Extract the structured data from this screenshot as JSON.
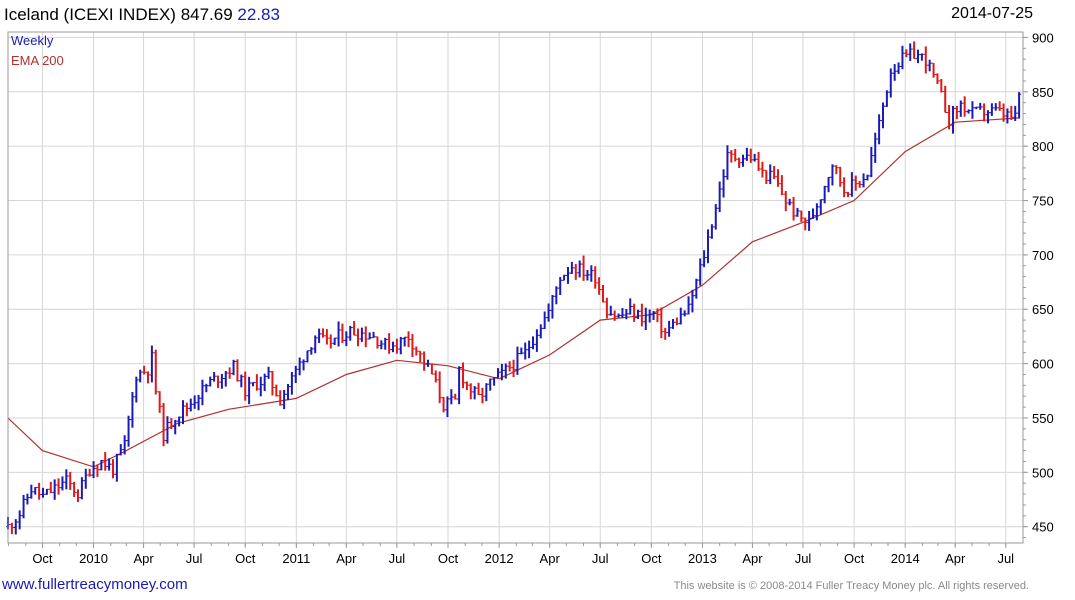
{
  "header": {
    "title": "Iceland (ICEXI INDEX)",
    "last": "847.69",
    "change": "22.83",
    "date": "2014-07-25"
  },
  "footer": {
    "link": "www.fullertreacymoney.com",
    "copyright": "This website is © 2008-2014 Fuller Treacy Money plc. All rights reserved."
  },
  "colors": {
    "up": "#1a1ab4",
    "down": "#dd1a1a",
    "ema": "#b03030",
    "grid": "#d6d6d6",
    "frame": "#9a9a9a"
  },
  "chart_data": {
    "type": "candlestick",
    "legend": [
      "Weekly",
      "EMA 200"
    ],
    "legend_colors": [
      "#1a1ab4",
      "#b03030"
    ],
    "y_ticks": [
      450,
      500,
      550,
      600,
      650,
      700,
      750,
      800,
      850,
      900
    ],
    "ylim": [
      435,
      905
    ],
    "x_ticks": [
      {
        "label": "Oct",
        "date": "2009-10-01"
      },
      {
        "label": "2010",
        "date": "2010-01-01"
      },
      {
        "label": "Apr",
        "date": "2010-04-01"
      },
      {
        "label": "Jul",
        "date": "2010-07-01"
      },
      {
        "label": "Oct",
        "date": "2010-10-01"
      },
      {
        "label": "2011",
        "date": "2011-01-01"
      },
      {
        "label": "Apr",
        "date": "2011-04-01"
      },
      {
        "label": "Jul",
        "date": "2011-07-01"
      },
      {
        "label": "Oct",
        "date": "2011-10-01"
      },
      {
        "label": "2012",
        "date": "2012-01-01"
      },
      {
        "label": "Apr",
        "date": "2012-04-01"
      },
      {
        "label": "Jul",
        "date": "2012-07-01"
      },
      {
        "label": "Oct",
        "date": "2012-10-01"
      },
      {
        "label": "2013",
        "date": "2013-01-01"
      },
      {
        "label": "Apr",
        "date": "2013-04-01"
      },
      {
        "label": "Jul",
        "date": "2013-07-01"
      },
      {
        "label": "Oct",
        "date": "2013-10-01"
      },
      {
        "label": "2014",
        "date": "2014-01-01"
      },
      {
        "label": "Apr",
        "date": "2014-04-01"
      },
      {
        "label": "Jul",
        "date": "2014-07-01"
      }
    ],
    "x_range": [
      "2009-07-31",
      "2014-08-01"
    ],
    "close_path": [
      [
        "2009-07-31",
        450
      ],
      [
        "2009-08-21",
        462
      ],
      [
        "2009-09-11",
        485
      ],
      [
        "2009-10-02",
        478
      ],
      [
        "2009-10-23",
        485
      ],
      [
        "2009-11-13",
        492
      ],
      [
        "2009-12-04",
        480
      ],
      [
        "2009-12-25",
        503
      ],
      [
        "2010-01-15",
        510
      ],
      [
        "2010-02-05",
        503
      ],
      [
        "2010-02-26",
        525
      ],
      [
        "2010-03-19",
        590
      ],
      [
        "2010-04-09",
        595
      ],
      [
        "2010-04-16",
        605
      ],
      [
        "2010-04-23",
        575
      ],
      [
        "2010-05-07",
        535
      ],
      [
        "2010-05-28",
        552
      ],
      [
        "2010-06-18",
        560
      ],
      [
        "2010-07-09",
        572
      ],
      [
        "2010-07-30",
        583
      ],
      [
        "2010-08-20",
        590
      ],
      [
        "2010-09-10",
        597
      ],
      [
        "2010-10-01",
        575
      ],
      [
        "2010-10-22",
        582
      ],
      [
        "2010-11-12",
        587
      ],
      [
        "2010-12-03",
        567
      ],
      [
        "2010-12-24",
        586
      ],
      [
        "2011-01-14",
        607
      ],
      [
        "2011-02-04",
        625
      ],
      [
        "2011-02-25",
        618
      ],
      [
        "2011-03-18",
        625
      ],
      [
        "2011-04-08",
        630
      ],
      [
        "2011-04-29",
        628
      ],
      [
        "2011-05-20",
        625
      ],
      [
        "2011-06-10",
        617
      ],
      [
        "2011-07-01",
        618
      ],
      [
        "2011-07-22",
        625
      ],
      [
        "2011-08-12",
        607
      ],
      [
        "2011-09-02",
        590
      ],
      [
        "2011-09-23",
        562
      ],
      [
        "2011-10-14",
        565
      ],
      [
        "2011-10-21",
        595
      ],
      [
        "2011-11-04",
        580
      ],
      [
        "2011-11-25",
        568
      ],
      [
        "2011-12-16",
        582
      ],
      [
        "2012-01-06",
        590
      ],
      [
        "2012-01-27",
        600
      ],
      [
        "2012-02-17",
        610
      ],
      [
        "2012-03-09",
        630
      ],
      [
        "2012-03-30",
        648
      ],
      [
        "2012-04-20",
        680
      ],
      [
        "2012-05-11",
        690
      ],
      [
        "2012-06-01",
        685
      ],
      [
        "2012-06-22",
        680
      ],
      [
        "2012-07-13",
        650
      ],
      [
        "2012-08-03",
        643
      ],
      [
        "2012-08-24",
        648
      ],
      [
        "2012-09-14",
        643
      ],
      [
        "2012-10-05",
        645
      ],
      [
        "2012-10-26",
        628
      ],
      [
        "2012-11-16",
        640
      ],
      [
        "2012-12-07",
        650
      ],
      [
        "2013-01-04",
        700
      ],
      [
        "2013-01-25",
        745
      ],
      [
        "2013-02-15",
        790
      ],
      [
        "2013-03-08",
        790
      ],
      [
        "2013-03-29",
        790
      ],
      [
        "2013-04-19",
        775
      ],
      [
        "2013-05-10",
        770
      ],
      [
        "2013-05-31",
        750
      ],
      [
        "2013-06-21",
        735
      ],
      [
        "2013-07-12",
        730
      ],
      [
        "2013-08-02",
        755
      ],
      [
        "2013-08-23",
        785
      ],
      [
        "2013-09-13",
        760
      ],
      [
        "2013-10-04",
        765
      ],
      [
        "2013-10-25",
        775
      ],
      [
        "2013-11-15",
        820
      ],
      [
        "2013-12-06",
        870
      ],
      [
        "2013-12-27",
        880
      ],
      [
        "2014-01-17",
        885
      ],
      [
        "2014-02-07",
        880
      ],
      [
        "2014-02-28",
        855
      ],
      [
        "2014-03-21",
        825
      ],
      [
        "2014-04-11",
        838
      ],
      [
        "2014-05-02",
        830
      ],
      [
        "2014-05-23",
        832
      ],
      [
        "2014-06-13",
        832
      ],
      [
        "2014-07-04",
        828
      ],
      [
        "2014-07-18",
        825
      ],
      [
        "2014-07-25",
        847.69
      ]
    ],
    "ema_path": [
      [
        "2009-07-31",
        550
      ],
      [
        "2009-10-01",
        520
      ],
      [
        "2010-01-01",
        505
      ],
      [
        "2010-03-01",
        520
      ],
      [
        "2010-06-01",
        545
      ],
      [
        "2010-09-01",
        558
      ],
      [
        "2011-01-01",
        568
      ],
      [
        "2011-04-01",
        590
      ],
      [
        "2011-07-01",
        603
      ],
      [
        "2011-10-01",
        598
      ],
      [
        "2012-01-01",
        586
      ],
      [
        "2012-04-01",
        608
      ],
      [
        "2012-07-01",
        640
      ],
      [
        "2012-10-01",
        645
      ],
      [
        "2013-01-01",
        672
      ],
      [
        "2013-04-01",
        712
      ],
      [
        "2013-07-01",
        730
      ],
      [
        "2013-10-01",
        750
      ],
      [
        "2014-01-01",
        795
      ],
      [
        "2014-04-01",
        822
      ],
      [
        "2014-07-25",
        826
      ]
    ]
  }
}
